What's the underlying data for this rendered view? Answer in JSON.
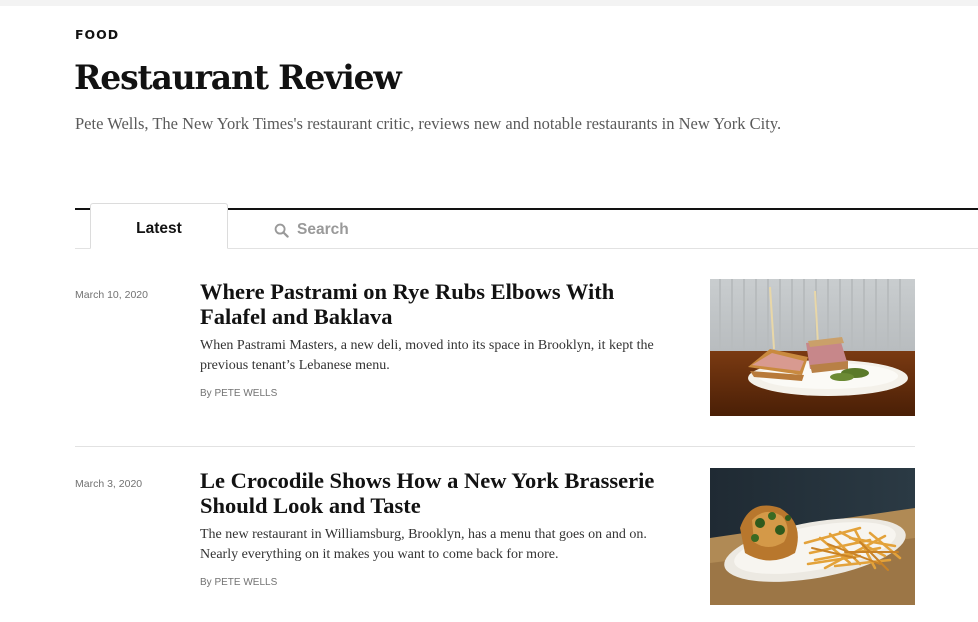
{
  "section": {
    "kicker": "FOOD"
  },
  "page": {
    "title": "Restaurant Review",
    "description": "Pete Wells, The New York Times's restaurant critic, reviews new and notable restaurants in New York City."
  },
  "tabs": {
    "latest_label": "Latest",
    "search_label": "Search"
  },
  "articles": [
    {
      "date": "March 10, 2020",
      "headline": "Where Pastrami on Rye Rubs Elbows With Falafel and Baklava",
      "summary": "When Pastrami Masters, a new deli, moved into its space in Brooklyn, it kept the previous tenant’s Lebanese menu.",
      "byline": "By PETE WELLS",
      "image_icon": "pastrami-sandwich-photo"
    },
    {
      "date": "March 3, 2020",
      "headline": "Le Crocodile Shows How a New York Brasserie Should Look and Taste",
      "summary": "The new restaurant in Williamsburg, Brooklyn, has a menu that goes on and on. Nearly everything on it makes you want to come back for more.",
      "byline": "By PETE WELLS",
      "image_icon": "chicken-and-fries-photo"
    }
  ]
}
